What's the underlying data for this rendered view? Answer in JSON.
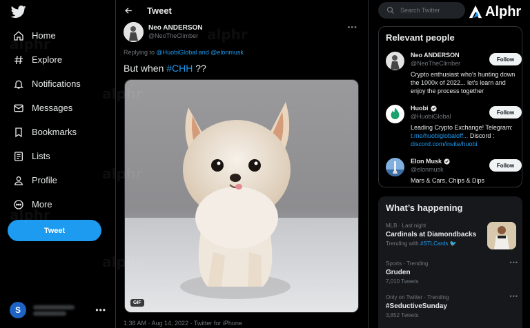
{
  "left_nav": {
    "logo_icon": "twitter-bird-icon",
    "items": [
      {
        "label": "Home",
        "icon": "home-icon"
      },
      {
        "label": "Explore",
        "icon": "hashtag-icon"
      },
      {
        "label": "Notifications",
        "icon": "bell-icon"
      },
      {
        "label": "Messages",
        "icon": "envelope-icon"
      },
      {
        "label": "Bookmarks",
        "icon": "bookmark-icon"
      },
      {
        "label": "Lists",
        "icon": "list-icon"
      },
      {
        "label": "Profile",
        "icon": "person-icon"
      },
      {
        "label": "More",
        "icon": "more-circle-icon"
      }
    ],
    "tweet_button": "Tweet",
    "account_initial": "S",
    "account_more": "•••"
  },
  "tweet_view": {
    "header_title": "Tweet",
    "author_name": "Neo ANDERSON",
    "author_handle": "@NeoTheClimber",
    "more": "•••",
    "reply_prefix": "Replying to ",
    "reply_user1": "@HuobiGlobal",
    "reply_and": " and ",
    "reply_user2": "@elonmusk",
    "text_before": "But when ",
    "hashtag": "#CHH",
    "text_after": " ??",
    "gif_label": "GIF",
    "meta": "1:38 AM · Aug 14, 2022 · Twitter for iPhone"
  },
  "search": {
    "placeholder": "Search Twitter"
  },
  "brand": {
    "name": "Alphr"
  },
  "relevant_people": {
    "title": "Relevant people",
    "people": [
      {
        "name": "Neo ANDERSON",
        "handle": "@NeoTheClimber",
        "bio": "Crypto enthusiast who's hunting down the 1000x of 2022... let's learn and enjoy the process together",
        "follow": "Follow",
        "verified": false
      },
      {
        "name": "Huobi",
        "handle": "@HuobiGlobal",
        "bio_text": "Leading Crypto Exchange! Telegram: ",
        "bio_link1": "t.me/huobiglobaloff...",
        "bio_mid": " Discord : ",
        "bio_link2": "discord.com/invite/huobi",
        "follow": "Follow",
        "verified": true
      },
      {
        "name": "Elon Musk",
        "handle": "@elonmusk",
        "bio": "Mars & Cars, Chips & Dips",
        "follow": "Follow",
        "verified": true
      }
    ]
  },
  "whats_happening": {
    "title": "What’s happening",
    "trends": [
      {
        "context": "MLB · Last night",
        "title": "Cardinals at Diamondbacks",
        "sub_prefix": "Trending with ",
        "sub_link": "#STLCards"
      },
      {
        "context": "Sports · Trending",
        "title": "Gruden",
        "sub": "7,010 Tweets",
        "more": "•••"
      },
      {
        "context": "Only on Twitter · Trending",
        "title": "#SeductiveSunday",
        "sub": "3,852 Tweets",
        "more": "•••"
      }
    ]
  },
  "watermark": "alphr",
  "colors": {
    "accent": "#1d9bf0",
    "background": "#000000",
    "border": "#2f3336",
    "muted": "#71767b"
  }
}
